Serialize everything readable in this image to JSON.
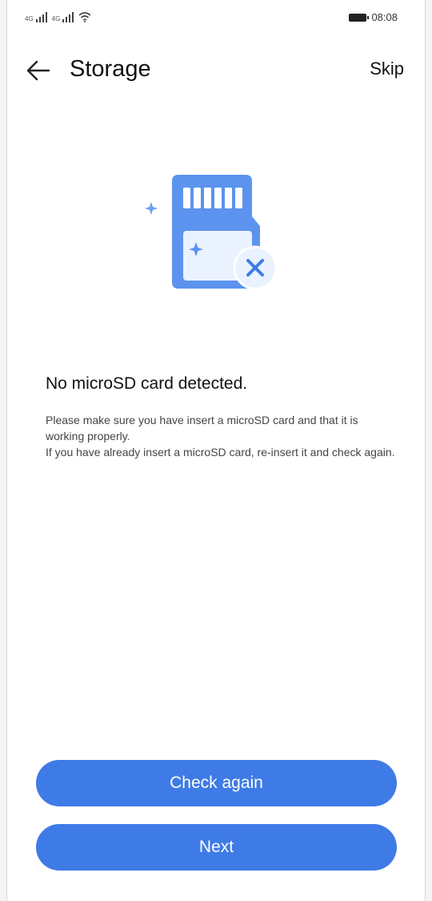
{
  "status_bar": {
    "signal_label_1": "4G",
    "signal_label_2": "4G",
    "time": "08:08"
  },
  "app_bar": {
    "title": "Storage",
    "skip_label": "Skip"
  },
  "content": {
    "illustration_icon": "microsd-card-not-detected-icon",
    "headline": "No microSD card detected.",
    "description_lines": [
      "Please make sure you have insert a microSD card and that it is working properly.",
      "If you have already insert a microSD card, re-insert it and check again."
    ]
  },
  "buttons": {
    "check_again": "Check again",
    "next": "Next"
  },
  "colors": {
    "accent": "#3f7be6",
    "card_blue": "#5b93ef",
    "card_light": "#eaf2ff"
  }
}
